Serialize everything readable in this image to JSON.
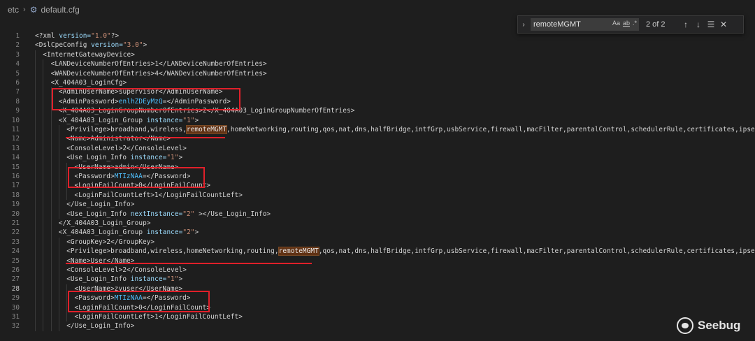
{
  "breadcrumb": {
    "folder": "etc",
    "separator": "›",
    "file_icon": "gear-icon",
    "file": "default.cfg"
  },
  "find": {
    "toggle_label": "›",
    "query": "remoteMGMT",
    "match_case": "Aa",
    "whole_word": "ab",
    "regex": ".*",
    "result": "2 of 2",
    "prev": "↑",
    "next": "↓",
    "selection": "☰",
    "close": "✕"
  },
  "colors": {
    "highlight": "#e0202a",
    "match_bg": "#613214",
    "editor_bg": "#1e1e1e"
  },
  "lines": [
    {
      "n": "1",
      "indent": 0,
      "segs": [
        {
          "t": "<?xml "
        },
        {
          "t": "version=",
          "c": "attr"
        },
        {
          "t": "\"1.0\"",
          "c": "str"
        },
        {
          "t": "?>"
        }
      ]
    },
    {
      "n": "2",
      "indent": 0,
      "segs": [
        {
          "t": "<DslCpeConfig "
        },
        {
          "t": "version=",
          "c": "attr"
        },
        {
          "t": "\"3.0\"",
          "c": "str"
        },
        {
          "t": ">"
        }
      ]
    },
    {
      "n": "3",
      "indent": 1,
      "segs": [
        {
          "t": "<InternetGatewayDevice>"
        }
      ]
    },
    {
      "n": "4",
      "indent": 2,
      "segs": [
        {
          "t": "<LANDeviceNumberOfEntries>1</LANDeviceNumberOfEntries>"
        }
      ]
    },
    {
      "n": "5",
      "indent": 2,
      "segs": [
        {
          "t": "<WANDeviceNumberOfEntries>4</WANDeviceNumberOfEntries>"
        }
      ]
    },
    {
      "n": "6",
      "indent": 2,
      "segs": [
        {
          "t": "<X_404A03_LoginCfg>"
        }
      ]
    },
    {
      "n": "7",
      "indent": 3,
      "segs": [
        {
          "t": "<AdminUserName>supervisor</AdminUserName>"
        }
      ]
    },
    {
      "n": "8",
      "indent": 3,
      "segs": [
        {
          "t": "<AdminPassword>"
        },
        {
          "t": "enlhZDEyMzQ",
          "c": "val"
        },
        {
          "t": "=</AdminPassword>"
        }
      ]
    },
    {
      "n": "9",
      "indent": 3,
      "segs": [
        {
          "t": "<X_404A03_LoginGroupNumberOfEntries>2</X_404A03_LoginGroupNumberOfEntries>"
        }
      ]
    },
    {
      "n": "10",
      "indent": 3,
      "segs": [
        {
          "t": "<X_404A03_Login_Group "
        },
        {
          "t": "instance=",
          "c": "attr"
        },
        {
          "t": "\"1\"",
          "c": "str"
        },
        {
          "t": ">"
        }
      ]
    },
    {
      "n": "11",
      "indent": 4,
      "segs": [
        {
          "t": "<Privilege>broadband,wireless,"
        },
        {
          "t": "remoteMGMT",
          "c": "mark"
        },
        {
          "t": ",homeNetworking,routing,qos,nat,dns,halfBridge,intfGrp,usbService,firewall,macFilter,parentalControl,schedulerRule,certificates,ipsecVPN,"
        }
      ]
    },
    {
      "n": "12",
      "indent": 4,
      "segs": [
        {
          "t": "<Name>Administrator</Name>"
        }
      ]
    },
    {
      "n": "13",
      "indent": 4,
      "segs": [
        {
          "t": "<ConsoleLevel>2</ConsoleLevel>"
        }
      ]
    },
    {
      "n": "14",
      "indent": 4,
      "segs": [
        {
          "t": "<Use_Login_Info "
        },
        {
          "t": "instance=",
          "c": "attr"
        },
        {
          "t": "\"1\"",
          "c": "str"
        },
        {
          "t": ">"
        }
      ]
    },
    {
      "n": "15",
      "indent": 5,
      "segs": [
        {
          "t": "<UserName>admin</UserName>"
        }
      ]
    },
    {
      "n": "16",
      "indent": 5,
      "segs": [
        {
          "t": "<Password>"
        },
        {
          "t": "MTIzNAA",
          "c": "val"
        },
        {
          "t": "=</Password>"
        }
      ]
    },
    {
      "n": "17",
      "indent": 5,
      "segs": [
        {
          "t": "<LoginFailCount>0</LoginFailCount>"
        }
      ]
    },
    {
      "n": "18",
      "indent": 5,
      "segs": [
        {
          "t": "<LoginFailCountLeft>1</LoginFailCountLeft>"
        }
      ]
    },
    {
      "n": "19",
      "indent": 4,
      "segs": [
        {
          "t": "</Use_Login_Info>"
        }
      ]
    },
    {
      "n": "20",
      "indent": 4,
      "segs": [
        {
          "t": "<Use_Login_Info "
        },
        {
          "t": "nextInstance=",
          "c": "attr"
        },
        {
          "t": "\"2\"",
          "c": "str"
        },
        {
          "t": " ></Use_Login_Info>"
        }
      ]
    },
    {
      "n": "21",
      "indent": 3,
      "segs": [
        {
          "t": "</X_404A03_Login_Group>"
        }
      ]
    },
    {
      "n": "22",
      "indent": 3,
      "segs": [
        {
          "t": "<X_404A03_Login_Group "
        },
        {
          "t": "instance=",
          "c": "attr"
        },
        {
          "t": "\"2\"",
          "c": "str"
        },
        {
          "t": ">"
        }
      ]
    },
    {
      "n": "23",
      "indent": 4,
      "segs": [
        {
          "t": "<GroupKey>2</GroupKey>"
        }
      ]
    },
    {
      "n": "24",
      "indent": 4,
      "segs": [
        {
          "t": "<Privilege>broadband,wireless,homeNetworking,routing,"
        },
        {
          "t": "remoteMGMT",
          "c": "mark"
        },
        {
          "t": ",qos,nat,dns,halfBridge,intfGrp,usbService,firewall,macFilter,parentalControl,schedulerRule,certificates,ipsecVPN,"
        }
      ]
    },
    {
      "n": "25",
      "indent": 4,
      "segs": [
        {
          "t": "<Name>User</Name>"
        }
      ]
    },
    {
      "n": "26",
      "indent": 4,
      "segs": [
        {
          "t": "<ConsoleLevel>2</ConsoleLevel>"
        }
      ]
    },
    {
      "n": "27",
      "indent": 4,
      "segs": [
        {
          "t": "<Use_Login_Info "
        },
        {
          "t": "instance=",
          "c": "attr"
        },
        {
          "t": "\"1\"",
          "c": "str"
        },
        {
          "t": ">"
        }
      ]
    },
    {
      "n": "28",
      "indent": 5,
      "active": true,
      "segs": [
        {
          "t": "<UserName>zyuser</UserName>"
        }
      ]
    },
    {
      "n": "29",
      "indent": 5,
      "segs": [
        {
          "t": "<Password>"
        },
        {
          "t": "MTIzNAA",
          "c": "val"
        },
        {
          "t": "=</Password>"
        }
      ]
    },
    {
      "n": "30",
      "indent": 5,
      "segs": [
        {
          "t": "<LoginFailCount>0</LoginFailCount>"
        }
      ]
    },
    {
      "n": "31",
      "indent": 5,
      "segs": [
        {
          "t": "<LoginFailCountLeft>1</LoginFailCountLeft>"
        }
      ]
    },
    {
      "n": "32",
      "indent": 4,
      "segs": [
        {
          "t": "</Use_Login_Info>"
        }
      ]
    }
  ],
  "watermark": {
    "text": "Seebug"
  }
}
